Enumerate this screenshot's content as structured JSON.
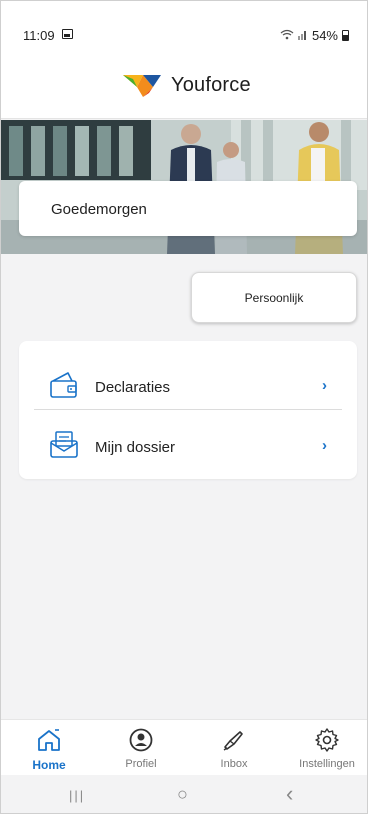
{
  "status_bar": {
    "time": "11:09",
    "battery": "54%",
    "icons": [
      "image-icon",
      "wifi-icon",
      "signal-icon",
      "battery-icon"
    ]
  },
  "header": {
    "brand": "Youforce",
    "logo_icon": "youforce-logo-icon"
  },
  "hero": {
    "greeting": "Goedemorgen"
  },
  "tabs": {
    "active_label": "Persoonlijk"
  },
  "menu": {
    "items": [
      {
        "label": "Declaraties",
        "icon": "wallet-icon",
        "chevron": "›"
      },
      {
        "label": "Mijn dossier",
        "icon": "dossier-icon",
        "chevron": "›"
      }
    ]
  },
  "bottom_nav": {
    "items": [
      {
        "label": "Home",
        "icon": "home-icon",
        "active": true
      },
      {
        "label": "Profiel",
        "icon": "profile-icon",
        "active": false
      },
      {
        "label": "Inbox",
        "icon": "inbox-icon",
        "active": false
      },
      {
        "label": "Instellingen",
        "icon": "gear-icon",
        "active": false
      }
    ]
  },
  "system_nav": {
    "recents": "|||",
    "home": "○",
    "back": "‹"
  },
  "colors": {
    "accent": "#1a73c9",
    "background": "#f3f3f4",
    "card": "#ffffff",
    "logo_green": "#4caf2e",
    "logo_orange": "#f28c1c",
    "logo_blue": "#1e56a0"
  }
}
